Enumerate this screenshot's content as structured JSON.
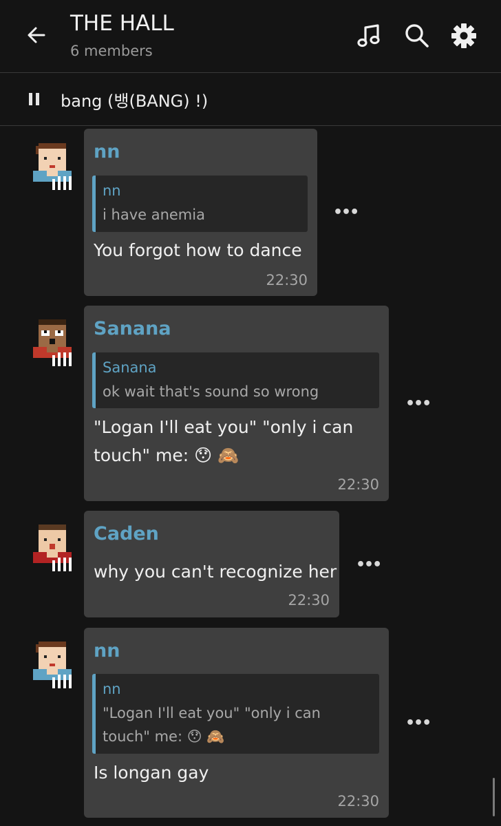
{
  "header": {
    "title": "THE HALL",
    "subtitle": "6 members",
    "icons": [
      "back-arrow-icon",
      "music-note-icon",
      "search-icon",
      "gear-icon"
    ]
  },
  "now_playing": {
    "track": "bang (뱅(BANG) !)",
    "icon": "pause-icon"
  },
  "messages": [
    {
      "sender": "nn",
      "quote_sender": "nn",
      "quote_text": [
        "i have anemia"
      ],
      "text": [
        "You forgot how to dance"
      ],
      "time": "22:30"
    },
    {
      "sender": "Sanana",
      "quote_sender": "Sanana",
      "quote_text": [
        "ok wait that's sound so wrong"
      ],
      "text": [
        "\"Logan I'll eat you\" \"only i can",
        "touch\" me: 😯 🙈"
      ],
      "time": "22:30"
    },
    {
      "sender": "Caden",
      "text": [
        "why you can't recognize her"
      ],
      "time": "22:30"
    },
    {
      "sender": "nn",
      "quote_sender": "nn",
      "quote_text": [
        "\"Logan I'll eat you\" \"only i can",
        "touch\" me: 😯 🙈"
      ],
      "text": [
        "Is longan gay"
      ],
      "time": "22:30"
    }
  ],
  "colors": {
    "background": "#141414",
    "bubble": "#3f3f3f",
    "accent": "#5fa3c4"
  }
}
